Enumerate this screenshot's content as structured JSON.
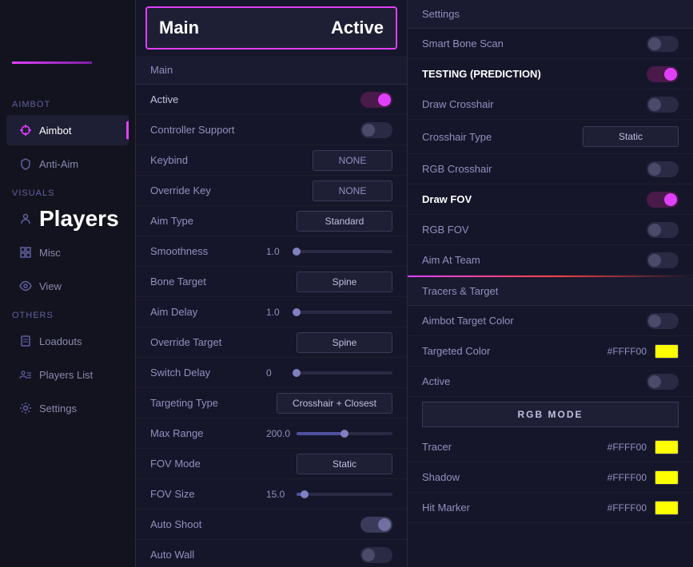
{
  "sidebar": {
    "logo_bar_visible": true,
    "sections": [
      {
        "label": "Aimbot",
        "items": [
          {
            "id": "aimbot",
            "label": "Aimbot",
            "active": true,
            "icon": "crosshair"
          },
          {
            "id": "anti-aim",
            "label": "Anti-Aim",
            "active": false,
            "icon": "shield"
          }
        ]
      },
      {
        "label": "Visuals",
        "items": [
          {
            "id": "players",
            "label": "Players",
            "active": false,
            "icon": "person"
          },
          {
            "id": "misc",
            "label": "Misc",
            "active": false,
            "icon": "grid"
          },
          {
            "id": "view",
            "label": "View",
            "active": false,
            "icon": "eye"
          }
        ]
      },
      {
        "label": "Others",
        "items": [
          {
            "id": "loadouts",
            "label": "Loadouts",
            "active": false,
            "icon": "file"
          },
          {
            "id": "players-list",
            "label": "Players List",
            "active": false,
            "icon": "person-list"
          },
          {
            "id": "settings",
            "label": "Settings",
            "active": false,
            "icon": "gear"
          }
        ]
      }
    ]
  },
  "header": {
    "section": "Main",
    "status": "Active"
  },
  "left_panel": {
    "section_label": "Main",
    "rows": [
      {
        "id": "active",
        "label": "Active",
        "type": "toggle",
        "value": true,
        "pink": true
      },
      {
        "id": "controller-support",
        "label": "Controller Support",
        "type": "toggle",
        "value": false,
        "pink": false
      },
      {
        "id": "keybind",
        "label": "Keybind",
        "type": "keybind",
        "value": "NONE"
      },
      {
        "id": "override-key",
        "label": "Override Key",
        "type": "keybind",
        "value": "NONE"
      },
      {
        "id": "aim-type",
        "label": "Aim Type",
        "type": "dropdown",
        "value": "Standard"
      },
      {
        "id": "smoothness",
        "label": "Smoothness",
        "type": "slider",
        "value": 1.0,
        "min": 0,
        "max": 5,
        "fill_pct": 0
      },
      {
        "id": "bone-target",
        "label": "Bone Target",
        "type": "dropdown",
        "value": "Spine"
      },
      {
        "id": "aim-delay",
        "label": "Aim Delay",
        "type": "slider",
        "value": 1.0,
        "min": 0,
        "max": 5,
        "fill_pct": 0
      },
      {
        "id": "override-target",
        "label": "Override Target",
        "type": "dropdown",
        "value": "Spine"
      },
      {
        "id": "switch-delay",
        "label": "Switch Delay",
        "type": "slider",
        "value": 0,
        "min": 0,
        "max": 5,
        "fill_pct": 0
      },
      {
        "id": "targeting-type",
        "label": "Targeting Type",
        "type": "dropdown",
        "value": "Crosshair + Closest"
      },
      {
        "id": "max-range",
        "label": "Max Range",
        "type": "slider",
        "value": 200.0,
        "min": 0,
        "max": 400,
        "fill_pct": 50
      },
      {
        "id": "fov-mode",
        "label": "FOV Mode",
        "type": "dropdown",
        "value": "Static"
      },
      {
        "id": "fov-size",
        "label": "FOV Size",
        "type": "slider",
        "value": 15.0,
        "min": 0,
        "max": 180,
        "fill_pct": 8
      },
      {
        "id": "auto-shoot",
        "label": "Auto Shoot",
        "type": "toggle",
        "value": true,
        "pink": false
      },
      {
        "id": "auto-wall",
        "label": "Auto Wall",
        "type": "toggle",
        "value": false,
        "pink": false
      }
    ]
  },
  "right_panel": {
    "section1": {
      "label": "Settings",
      "rows": [
        {
          "id": "smart-bone-scan",
          "label": "Smart Bone Scan",
          "type": "toggle",
          "value": false,
          "pink": false
        },
        {
          "id": "testing-prediction",
          "label": "TESTING (PREDICTION)",
          "type": "toggle",
          "value": true,
          "pink": true,
          "bright": true
        },
        {
          "id": "draw-crosshair",
          "label": "Draw Crosshair",
          "type": "toggle",
          "value": false,
          "pink": false
        },
        {
          "id": "crosshair-type",
          "label": "Crosshair Type",
          "type": "dropdown",
          "value": "Static"
        },
        {
          "id": "rgb-crosshair",
          "label": "RGB Crosshair",
          "type": "toggle",
          "value": false,
          "pink": false
        },
        {
          "id": "draw-fov",
          "label": "Draw FOV",
          "type": "toggle",
          "value": true,
          "pink": true,
          "bright": true
        },
        {
          "id": "rgb-fov",
          "label": "RGB FOV",
          "type": "toggle",
          "value": false,
          "pink": false
        },
        {
          "id": "aim-at-team",
          "label": "Aim At Team",
          "type": "toggle",
          "value": false,
          "pink": false
        }
      ]
    },
    "section2": {
      "label": "Tracers & Target",
      "rows": [
        {
          "id": "aimbot-target-color",
          "label": "Aimbot Target Color",
          "type": "toggle",
          "value": false,
          "pink": false
        },
        {
          "id": "targeted-color",
          "label": "Targeted Color",
          "type": "color",
          "value": "#FFFF00",
          "swatch": "#FFFF00"
        },
        {
          "id": "active2",
          "label": "Active",
          "type": "toggle",
          "value": false,
          "pink": false
        },
        {
          "id": "rgb-mode",
          "label": "RGB MODE",
          "type": "button"
        },
        {
          "id": "tracer",
          "label": "Tracer",
          "type": "color",
          "value": "#FFFF00",
          "swatch": "#FFFF00"
        },
        {
          "id": "shadow",
          "label": "Shadow",
          "type": "color",
          "value": "#FFFF00",
          "swatch": "#FFFF00"
        },
        {
          "id": "hit-marker",
          "label": "Hit Marker",
          "type": "color",
          "value": "#FFFF00",
          "swatch": "#FFFF00"
        }
      ]
    }
  },
  "players_label": "Players",
  "players_list_label": "Players List"
}
